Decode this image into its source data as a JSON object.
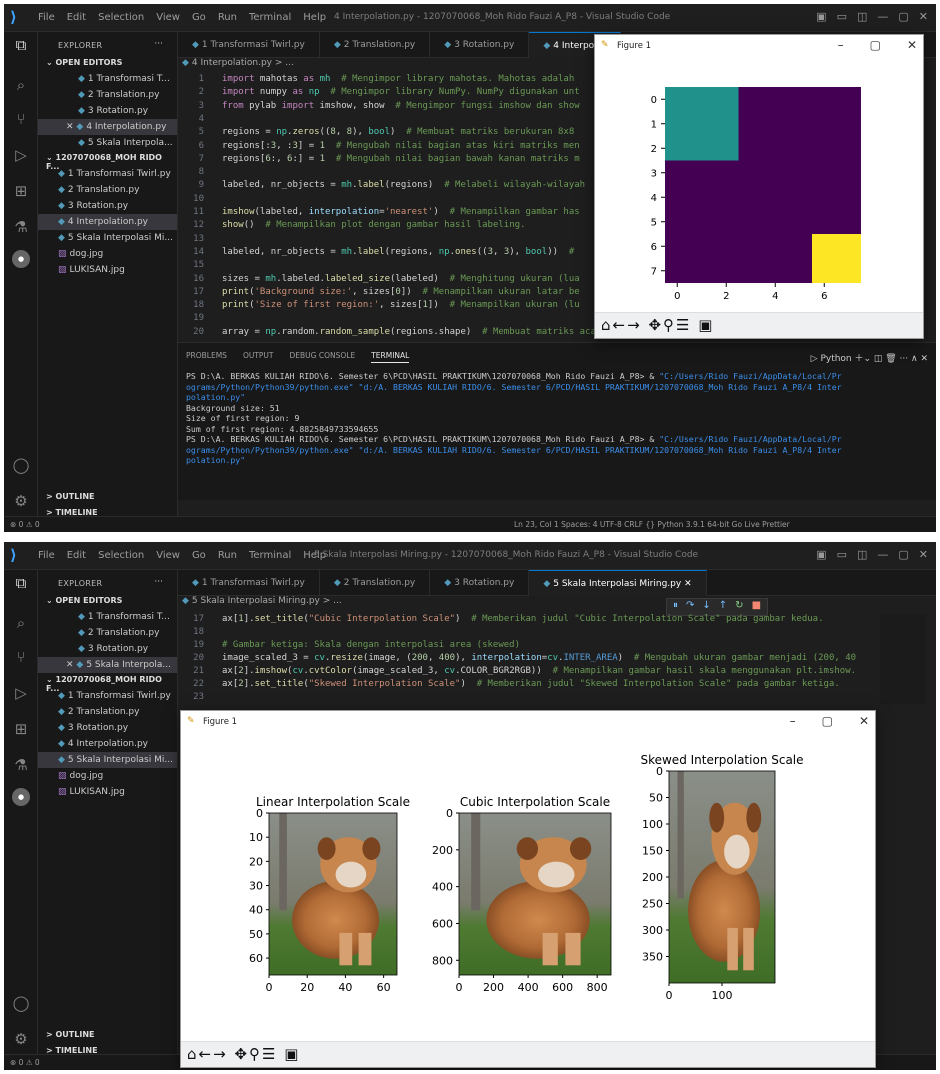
{
  "s1": {
    "menu": [
      "File",
      "Edit",
      "Selection",
      "View",
      "Go",
      "Run",
      "Terminal",
      "Help"
    ],
    "window_title": "4 Interpolation.py - 1207070068_Moh Rido Fauzi A_P8 - Visual Studio Code",
    "explorer_label": "EXPLORER",
    "open_editors_label": "OPEN EDITORS",
    "open_editors": [
      "1 Transformasi T...",
      "2 Translation.py",
      "3 Rotation.py",
      "4 Interpolation.py",
      "5 Skala Interpola..."
    ],
    "folder_label": "1207070068_MOH RIDO F...",
    "files": [
      "1 Transformasi Twirl.py",
      "2 Translation.py",
      "3 Rotation.py",
      "4 Interpolation.py",
      "5 Skala Interpolasi Mi...",
      "dog.jpg",
      "LUKISAN.jpg"
    ],
    "outline_label": "OUTLINE",
    "timeline_label": "TIMELINE",
    "tabs": [
      "1 Transformasi Twirl.py",
      "2 Translation.py",
      "3 Rotation.py",
      "4 Interpolat"
    ],
    "breadcrumb": "4 Interpolation.py > ...",
    "line_numbers": [
      "1",
      "2",
      "3",
      "4",
      "5",
      "6",
      "7",
      "8",
      "9",
      "10",
      "11",
      "12",
      "13",
      "14",
      "15",
      "16",
      "17",
      "18",
      "19",
      "20"
    ],
    "code": [
      [
        "import mahotas as mh",
        "  # Mengimpor library mahotas. Mahotas adalah"
      ],
      [
        "import numpy as np",
        "  # Mengimpor library NumPy. NumPy digunakan unt"
      ],
      [
        "from pylab import imshow, show",
        "  # Mengimpor fungsi imshow dan show"
      ],
      [
        "",
        ""
      ],
      [
        "regions = np.zeros((8, 8), bool)",
        "  # Membuat matriks berukuran 8x8"
      ],
      [
        "regions[:3, :3] = 1",
        "  # Mengubah nilai bagian atas kiri matriks men"
      ],
      [
        "regions[6:, 6:] = 1",
        "  # Mengubah nilai bagian bawah kanan matriks m"
      ],
      [
        "",
        ""
      ],
      [
        "labeled, nr_objects = mh.label(regions)",
        "  # Melabeli wilayah-wilayah"
      ],
      [
        "",
        ""
      ],
      [
        "imshow(labeled, interpolation='nearest')",
        "  # Menampilkan gambar has"
      ],
      [
        "show()",
        "  # Menampilkan plot dengan gambar hasil labeling."
      ],
      [
        "",
        ""
      ],
      [
        "labeled, nr_objects = mh.label(regions, np.ones((3, 3), bool))",
        "  #"
      ],
      [
        "",
        ""
      ],
      [
        "sizes = mh.labeled.labeled_size(labeled)",
        "  # Menghitung ukuran (lua"
      ],
      [
        "print('Background size:', sizes[0])",
        "  # Menampilkan ukuran latar be"
      ],
      [
        "print('Size of first region:', sizes[1])",
        "  # Menampilkan ukuran (lu"
      ],
      [
        "",
        ""
      ],
      [
        "array = np.random.random_sample(regions.shape)",
        "  # Membuat matriks acak dengan ukuran yang sama dengan matriks regions"
      ]
    ],
    "panel_tabs": [
      "PROBLEMS",
      "OUTPUT",
      "DEBUG CONSOLE",
      "TERMINAL"
    ],
    "panel_right": "Python",
    "terminal": [
      [
        "PS D:\\A. BERKAS KULIAH RIDO\\6. Semester 6\\PCD\\HASIL PRAKTIKUM\\1207070068_Moh Rido Fauzi A_P8> & ",
        "\"C:/Users/Rido Fauzi/AppData/Local/Pr"
      ],
      [
        "",
        "ograms/Python/Python39/python.exe\" \"d:/A. BERKAS KULIAH RIDO/6. Semester 6/PCD/HASIL PRAKTIKUM/1207070068_Moh Rido Fauzi A_P8/4 Inter"
      ],
      [
        "",
        "polation.py\""
      ],
      [
        "Background size: 51",
        ""
      ],
      [
        "Size of first region: 9",
        ""
      ],
      [
        "Sum of first region: 4.8825849733594655",
        ""
      ],
      [
        "PS D:\\A. BERKAS KULIAH RIDO\\6. Semester 6\\PCD\\HASIL PRAKTIKUM\\1207070068_Moh Rido Fauzi A_P8> & ",
        "\"C:/Users/Rido Fauzi/AppData/Local/Pr"
      ],
      [
        "",
        "ograms/Python/Python39/python.exe\" \"d:/A. BERKAS KULIAH RIDO/6. Semester 6/PCD/HASIL PRAKTIKUM/1207070068_Moh Rido Fauzi A_P8/4 Inter"
      ],
      [
        "",
        "polation.py\""
      ]
    ],
    "status_left": "⊗ 0 ⚠ 0",
    "status_right": "Ln 23, Col 1   Spaces: 4   UTF-8   CRLF   {} Python   3.9.1 64-bit   Go Live   Prettier",
    "figure_title": "Figure 1",
    "figure_y_ticks": [
      "0",
      "1",
      "2",
      "3",
      "4",
      "5",
      "6",
      "7"
    ],
    "figure_x_ticks": [
      "0",
      "2",
      "4",
      "6"
    ],
    "colors": {
      "background": "#440154",
      "region1": "#21918c",
      "region2": "#fde725"
    }
  },
  "s2": {
    "window_title": "5 Skala Interpolasi Miring.py - 1207070068_Moh Rido Fauzi A_P8 - Visual Studio Code",
    "open_editors": [
      "1 Transformasi T...",
      "2 Translation.py",
      "3 Rotation.py",
      "5 Skala Interpola..."
    ],
    "files": [
      "1 Transformasi Twirl.py",
      "2 Translation.py",
      "3 Rotation.py",
      "4 Interpolation.py",
      "5 Skala Interpolasi Mi...",
      "dog.jpg",
      "LUKISAN.jpg"
    ],
    "tabs": [
      "1 Transformasi Twirl.py",
      "2 Translation.py",
      "3 Rotation.py",
      "5 Skala Interpolasi Miring.py"
    ],
    "breadcrumb": "5 Skala Interpolasi Miring.py > ...",
    "line_numbers": [
      "17",
      "18",
      "19",
      "20",
      "21",
      "22",
      "23"
    ],
    "code": [
      [
        "ax[1].set_title(\"Cubic Interpolation Scale\")",
        "  # Memberikan judul \"Cubic Interpolation Scale\" pada gambar kedua."
      ],
      [
        "",
        ""
      ],
      [
        "",
        "# Gambar ketiga: Skala dengan interpolasi area (skewed)"
      ],
      [
        "image_scaled_3 = cv.resize(image, (200, 400), interpolation=cv.INTER_AREA)",
        "  # Mengubah ukuran gambar menjadi (200, 40"
      ],
      [
        "ax[2].imshow(cv.cvtColor(image_scaled_3, cv.COLOR_BGR2RGB))",
        "  # Menampilkan gambar hasil skala menggunakan plt.imshow."
      ],
      [
        "ax[2].set_title(\"Skewed Interpolation Scale\")",
        "  # Memberikan judul \"Skewed Interpolation Scale\" pada gambar ketiga."
      ],
      [
        "",
        ""
      ]
    ],
    "figure_title": "Figure 1",
    "plots": [
      {
        "title": "Linear Interpolation Scale",
        "y_ticks": [
          "0",
          "10",
          "20",
          "30",
          "40",
          "50",
          "60"
        ],
        "x_ticks": [
          "0",
          "20",
          "40",
          "60"
        ]
      },
      {
        "title": "Cubic Interpolation Scale",
        "y_ticks": [
          "0",
          "200",
          "400",
          "600",
          "800"
        ],
        "x_ticks": [
          "0",
          "200",
          "400",
          "600",
          "800"
        ]
      },
      {
        "title": "Skewed Interpolation Scale",
        "y_ticks": [
          "0",
          "50",
          "100",
          "150",
          "200",
          "250",
          "300",
          "350"
        ],
        "x_ticks": [
          "0",
          "100"
        ]
      }
    ]
  }
}
